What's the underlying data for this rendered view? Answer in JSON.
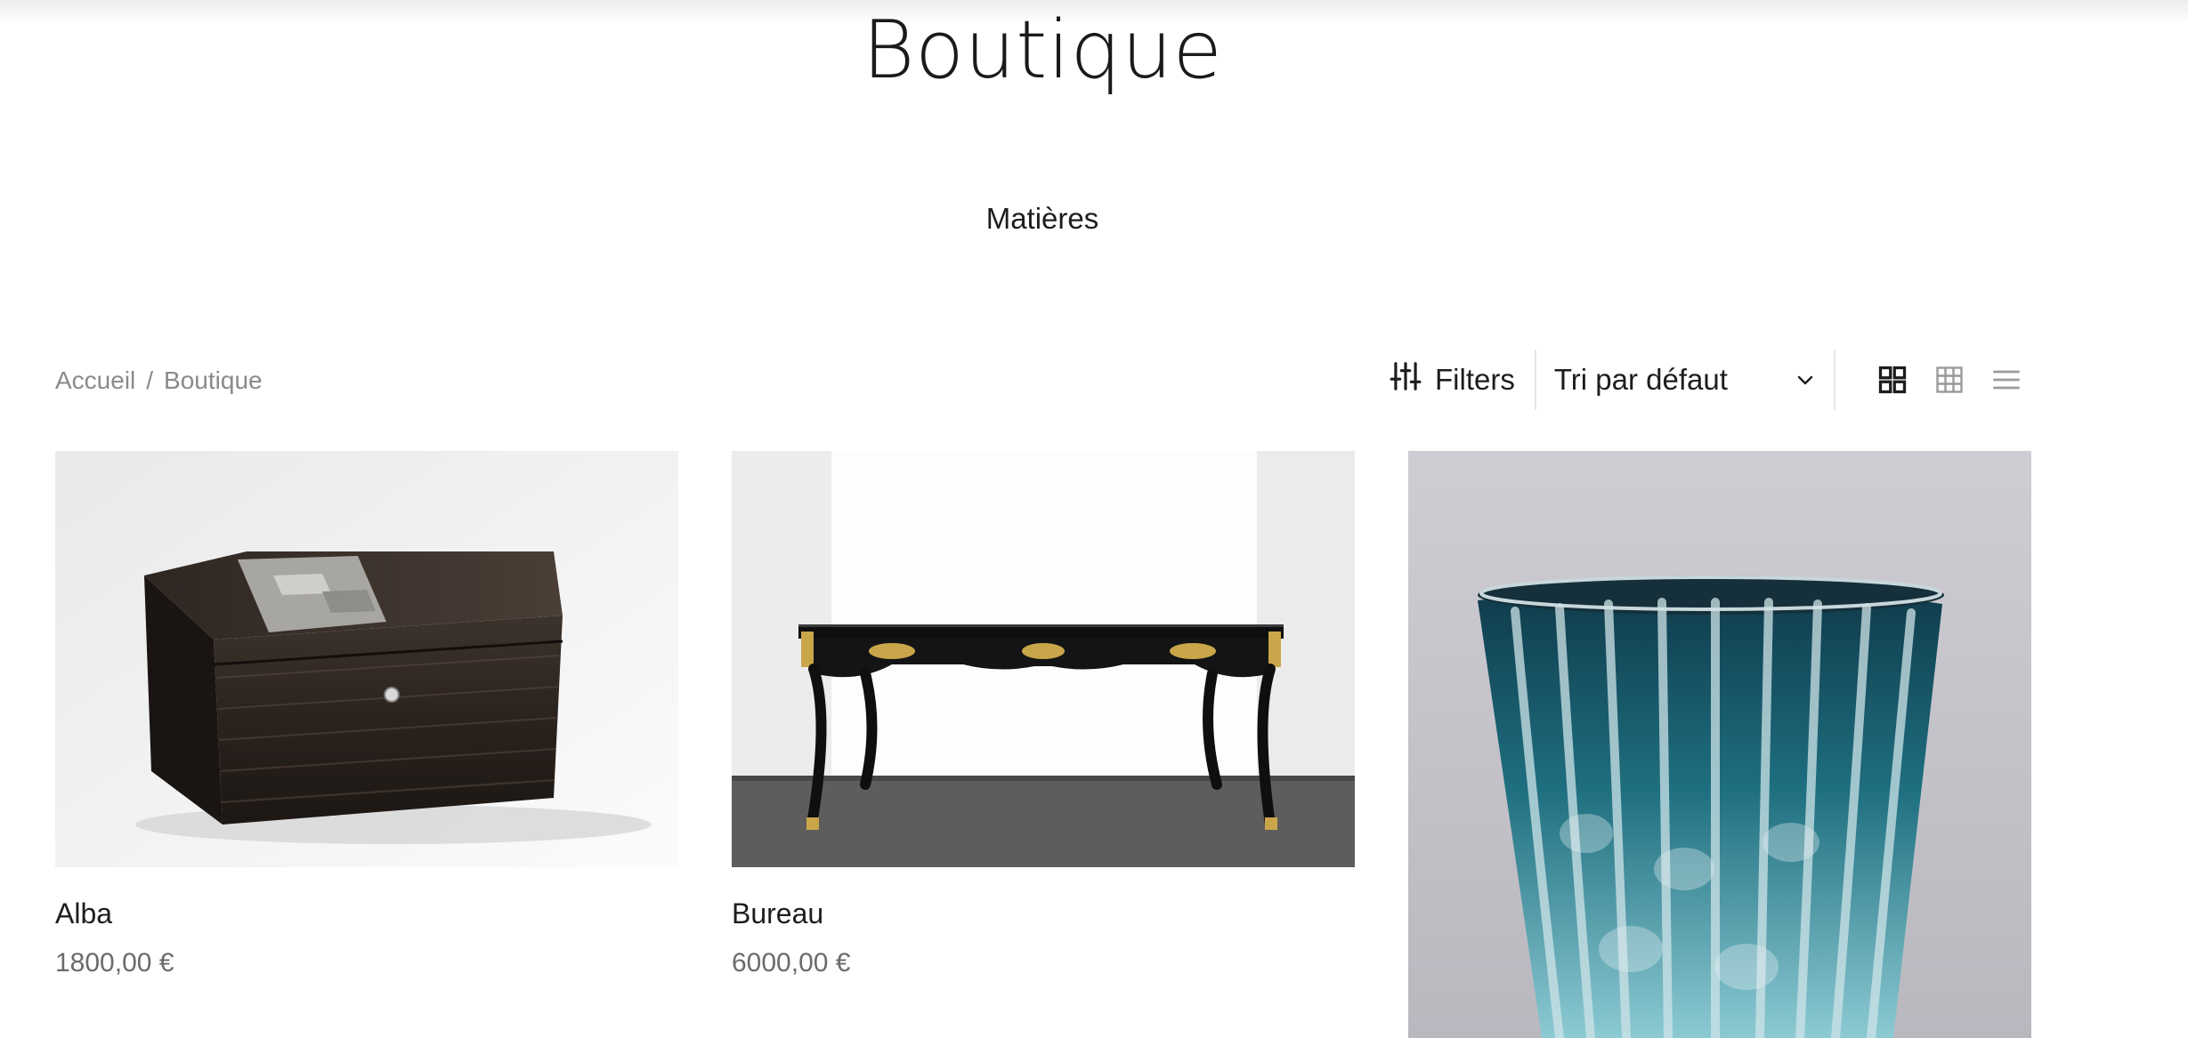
{
  "page": {
    "title": "Boutique",
    "category_link": "Matières"
  },
  "breadcrumb": {
    "home": "Accueil",
    "separator": "/",
    "current": "Boutique"
  },
  "toolbar": {
    "filters_label": "Filters",
    "filters_icon": "sliders-icon",
    "sort_value": "Tri par défaut",
    "sort_icon": "chevron-down-icon",
    "view_options": [
      "grid-2-icon",
      "grid-3-icon",
      "list-icon"
    ],
    "active_view": "grid-2-icon"
  },
  "products": [
    {
      "name": "Alba",
      "price": "1800,00 €"
    },
    {
      "name": "Bureau",
      "price": "6000,00 €"
    },
    {
      "name": "",
      "price": ""
    }
  ],
  "colors": {
    "text": "#1d1d1d",
    "muted": "#8a8a8a",
    "price": "#6b6b6b",
    "divider": "#e6e6e6"
  }
}
